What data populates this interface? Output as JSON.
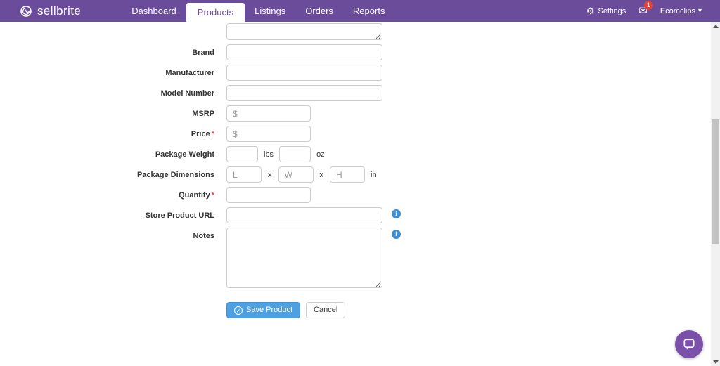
{
  "navbar": {
    "brand": "sellbrite",
    "items": [
      {
        "label": "Dashboard"
      },
      {
        "label": "Products"
      },
      {
        "label": "Listings"
      },
      {
        "label": "Orders"
      },
      {
        "label": "Reports"
      }
    ],
    "settings": "Settings",
    "badge_count": "1",
    "account": "Ecomclips"
  },
  "form": {
    "brand_label": "Brand",
    "manufacturer_label": "Manufacturer",
    "model_number_label": "Model Number",
    "msrp_label": "MSRP",
    "msrp_placeholder": "$",
    "price_label": "Price",
    "price_placeholder": "$",
    "required_marker": "*",
    "package_weight_label": "Package Weight",
    "weight_unit_lbs": "lbs",
    "weight_unit_oz": "oz",
    "package_dimensions_label": "Package Dimensions",
    "dim_l_placeholder": "L",
    "dim_w_placeholder": "W",
    "dim_h_placeholder": "H",
    "dim_separator": "x",
    "dim_unit": "in",
    "quantity_label": "Quantity",
    "store_product_url_label": "Store Product URL",
    "notes_label": "Notes",
    "save_button": "Save Product",
    "cancel_button": "Cancel"
  },
  "icons": {
    "gear": "⚙",
    "envelope": "✉",
    "caret_down": "▾",
    "check": "✓",
    "info": "i"
  },
  "colors": {
    "navbar_purple": "#6b4c9b",
    "save_button_blue": "#4fa0e0",
    "info_icon_blue": "#3d8fd1",
    "badge_red": "#e0433c",
    "chat_purple": "#7a50a8"
  }
}
